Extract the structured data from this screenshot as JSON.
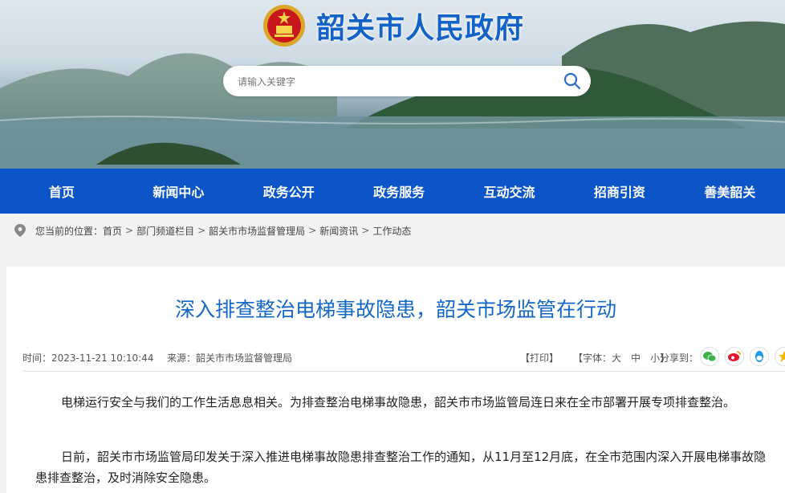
{
  "site": {
    "title": "韶关市人民政府"
  },
  "search": {
    "placeholder": "请输入关键字"
  },
  "nav": {
    "items": [
      "首页",
      "新闻中心",
      "政务公开",
      "政务服务",
      "互动交流",
      "招商引资",
      "善美韶关"
    ]
  },
  "breadcrumb": {
    "prefix": "您当前的位置：",
    "items": [
      "首页",
      "部门频道栏目",
      "韶关市市场监督管理局",
      "新闻资讯",
      "工作动态"
    ]
  },
  "article": {
    "title": "深入排查整治电梯事故隐患，韶关市场监管在行动",
    "time": "时间：2023-11-21 10:10:44",
    "source": "来源：韶关市市场监督管理局",
    "print_label": "【打印】",
    "font_label": "【字体：",
    "font_sizes": [
      "大",
      "中",
      "小"
    ],
    "font_close": "】",
    "share_label": "分享到：",
    "paragraphs": [
      "电梯运行安全与我们的工作生活息息相关。为排查整治电梯事故隐患，韶关市市场监管局连日来在全市部署开展专项排查整治。",
      "日前，韶关市市场监管局印发关于深入推进电梯事故隐患排查整治工作的通知，从11月至12月底，在全市范围内深入开展电梯事故隐患排查整治，及时消除安全隐患。"
    ]
  },
  "colors": {
    "nav_bg": "#0b55c8",
    "title": "#1468c8",
    "site_title": "#1262c8"
  },
  "icons": {
    "share": [
      "wechat-icon",
      "weibo-icon",
      "qq-icon",
      "qzone-icon"
    ]
  }
}
